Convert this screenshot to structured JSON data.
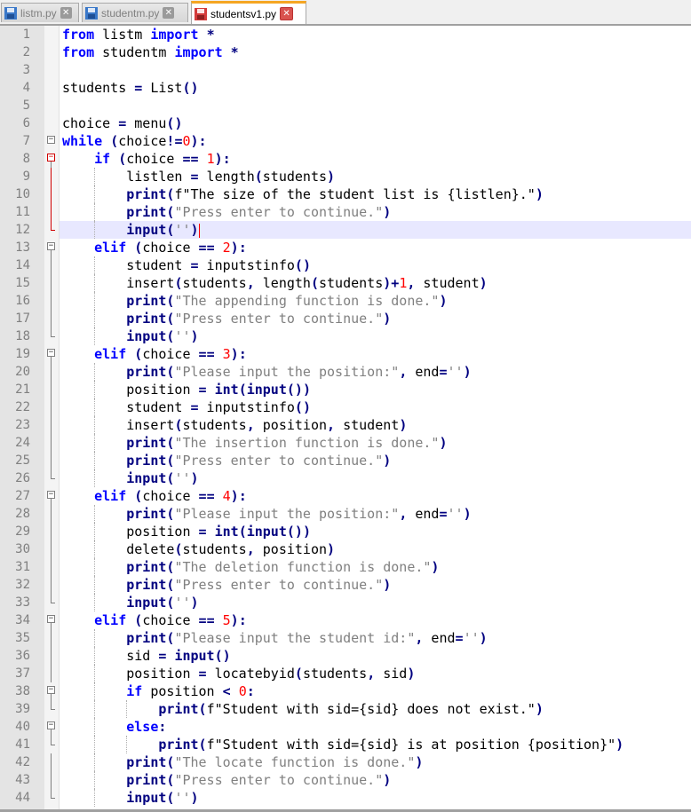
{
  "tabs": [
    {
      "label": "listm.py",
      "active": false,
      "icon": "save-disk-icon"
    },
    {
      "label": "studentm.py",
      "active": false,
      "icon": "save-disk-icon"
    },
    {
      "label": "studentsv1.py",
      "active": true,
      "icon": "unsaved-disk-icon"
    }
  ],
  "colors": {
    "keyword": "#0000ff",
    "builtin": "#000080",
    "number": "#ff0000",
    "string": "#808080",
    "active_tab_accent": "#f5a623",
    "current_line": "#e8e8ff"
  },
  "current_line": 12,
  "lines": [
    {
      "n": "1",
      "code": "from listm import *"
    },
    {
      "n": "2",
      "code": "from studentm import *"
    },
    {
      "n": "3",
      "code": ""
    },
    {
      "n": "4",
      "code": "students = List()"
    },
    {
      "n": "5",
      "code": ""
    },
    {
      "n": "6",
      "code": "choice = menu()"
    },
    {
      "n": "7",
      "code": "while (choice!=0):"
    },
    {
      "n": "8",
      "code": "    if (choice == 1):"
    },
    {
      "n": "9",
      "code": "        listlen = length(students)"
    },
    {
      "n": "10",
      "code": "        print(f\"The size of the student list is {listlen}.\")"
    },
    {
      "n": "11",
      "code": "        print(\"Press enter to continue.\")"
    },
    {
      "n": "12",
      "code": "        input('')"
    },
    {
      "n": "13",
      "code": "    elif (choice == 2):"
    },
    {
      "n": "14",
      "code": "        student = inputstinfo()"
    },
    {
      "n": "15",
      "code": "        insert(students, length(students)+1, student)"
    },
    {
      "n": "16",
      "code": "        print(\"The appending function is done.\")"
    },
    {
      "n": "17",
      "code": "        print(\"Press enter to continue.\")"
    },
    {
      "n": "18",
      "code": "        input('')"
    },
    {
      "n": "19",
      "code": "    elif (choice == 3):"
    },
    {
      "n": "20",
      "code": "        print(\"Please input the position:\", end='')"
    },
    {
      "n": "21",
      "code": "        position = int(input())"
    },
    {
      "n": "22",
      "code": "        student = inputstinfo()"
    },
    {
      "n": "23",
      "code": "        insert(students, position, student)"
    },
    {
      "n": "24",
      "code": "        print(\"The insertion function is done.\")"
    },
    {
      "n": "25",
      "code": "        print(\"Press enter to continue.\")"
    },
    {
      "n": "26",
      "code": "        input('')"
    },
    {
      "n": "27",
      "code": "    elif (choice == 4):"
    },
    {
      "n": "28",
      "code": "        print(\"Please input the position:\", end='')"
    },
    {
      "n": "29",
      "code": "        position = int(input())"
    },
    {
      "n": "30",
      "code": "        delete(students, position)"
    },
    {
      "n": "31",
      "code": "        print(\"The deletion function is done.\")"
    },
    {
      "n": "32",
      "code": "        print(\"Press enter to continue.\")"
    },
    {
      "n": "33",
      "code": "        input('')"
    },
    {
      "n": "34",
      "code": "    elif (choice == 5):"
    },
    {
      "n": "35",
      "code": "        print(\"Please input the student id:\", end='')"
    },
    {
      "n": "36",
      "code": "        sid = input()"
    },
    {
      "n": "37",
      "code": "        position = locatebyid(students, sid)"
    },
    {
      "n": "38",
      "code": "        if position < 0:"
    },
    {
      "n": "39",
      "code": "            print(f\"Student with sid={sid} does not exist.\")"
    },
    {
      "n": "40",
      "code": "        else:"
    },
    {
      "n": "41",
      "code": "            print(f\"Student with sid={sid} is at position {position}\")"
    },
    {
      "n": "42",
      "code": "        print(\"The locate function is done.\")"
    },
    {
      "n": "43",
      "code": "        print(\"Press enter to continue.\")"
    },
    {
      "n": "44",
      "code": "        input('')"
    }
  ]
}
